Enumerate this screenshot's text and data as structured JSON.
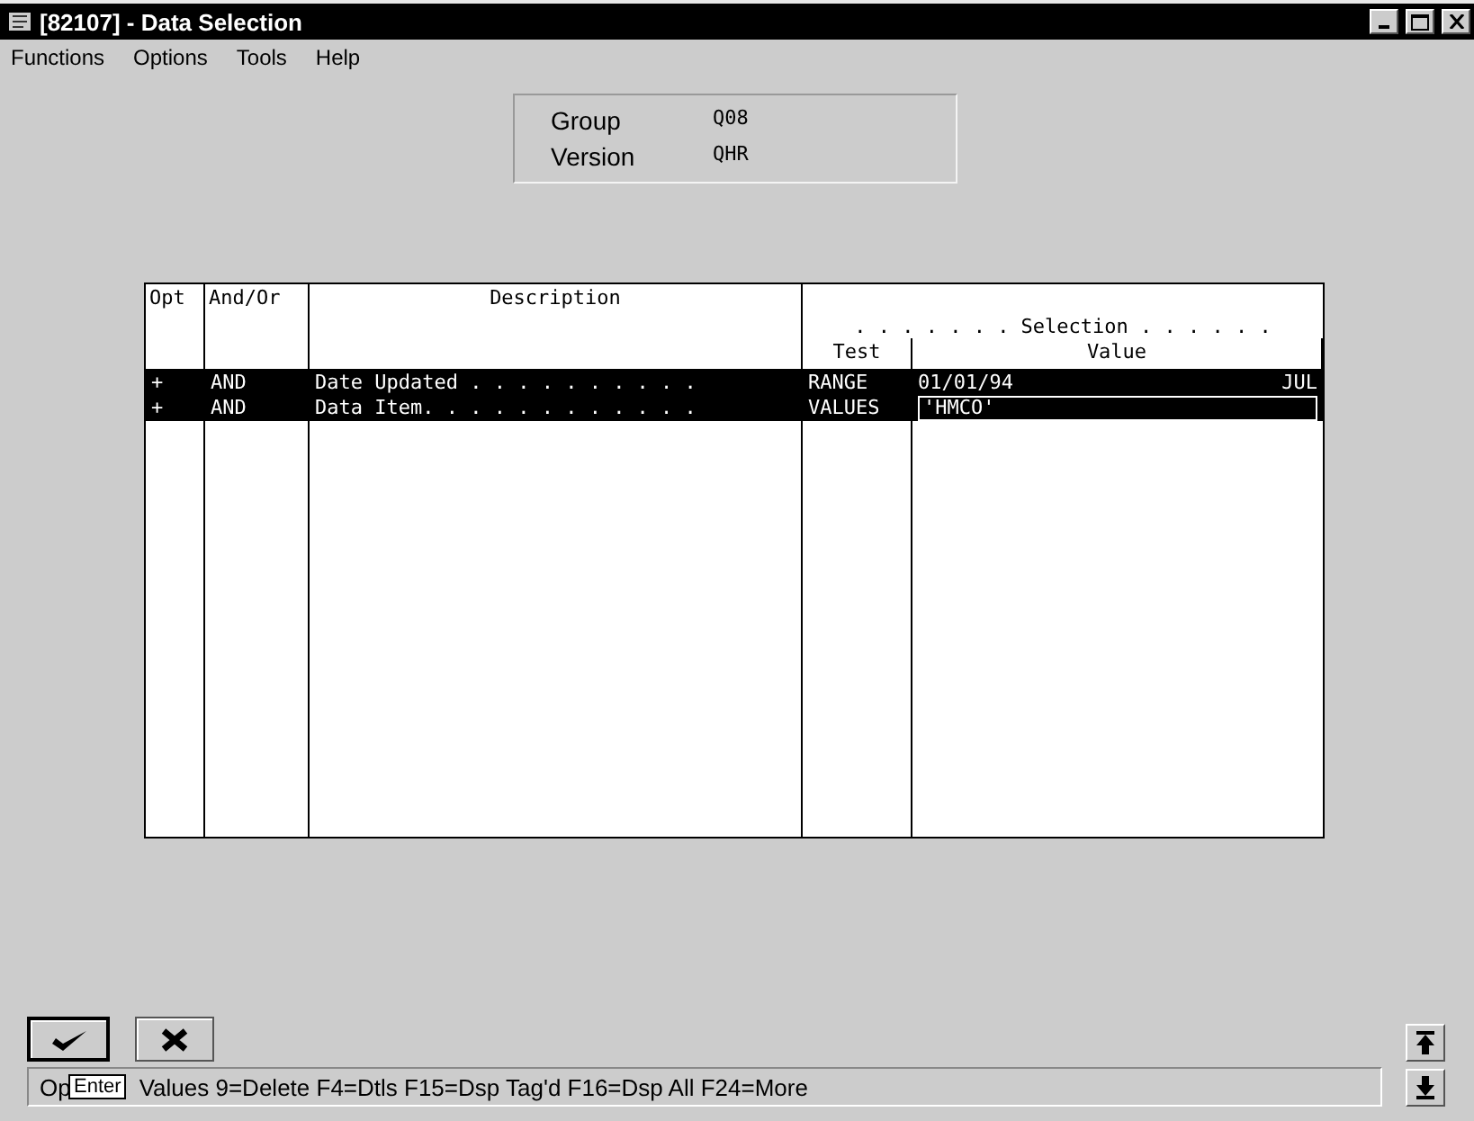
{
  "window": {
    "title": "[82107] - Data Selection"
  },
  "menu": [
    "Functions",
    "Options",
    "Tools",
    "Help"
  ],
  "header_fields": [
    {
      "label": "Group",
      "value": "Q08"
    },
    {
      "label": "Version",
      "value": "QHR"
    }
  ],
  "table": {
    "columns": [
      {
        "label": "Opt"
      },
      {
        "label": "And/Or"
      },
      {
        "label": "Description"
      },
      {
        "group": ". . . . . . . Selection . . . . . .",
        "label": "Test"
      },
      {
        "label": "Value"
      }
    ],
    "rows": [
      {
        "opt": "+",
        "and_or": "AND",
        "description": "Date Updated . . . . . . . . . .",
        "test": "RANGE",
        "value": "01/01/94",
        "value_end": "JUL",
        "selected": true,
        "focused": false
      },
      {
        "opt": "+",
        "and_or": "AND",
        "description": "Data Item. . . . . . . . . . . .",
        "test": "VALUES",
        "value": "'HMCO'",
        "selected": true,
        "focused": true
      }
    ]
  },
  "buttons": [
    {
      "kind": "ok"
    },
    {
      "kind": "cancel"
    }
  ],
  "status_bar": {
    "text_start": "Op",
    "text_end": "Values  9=Delete  F4=Dtls  F15=Dsp Tag'd  F16=Dsp All  F24=More"
  },
  "tooltip": "Enter"
}
